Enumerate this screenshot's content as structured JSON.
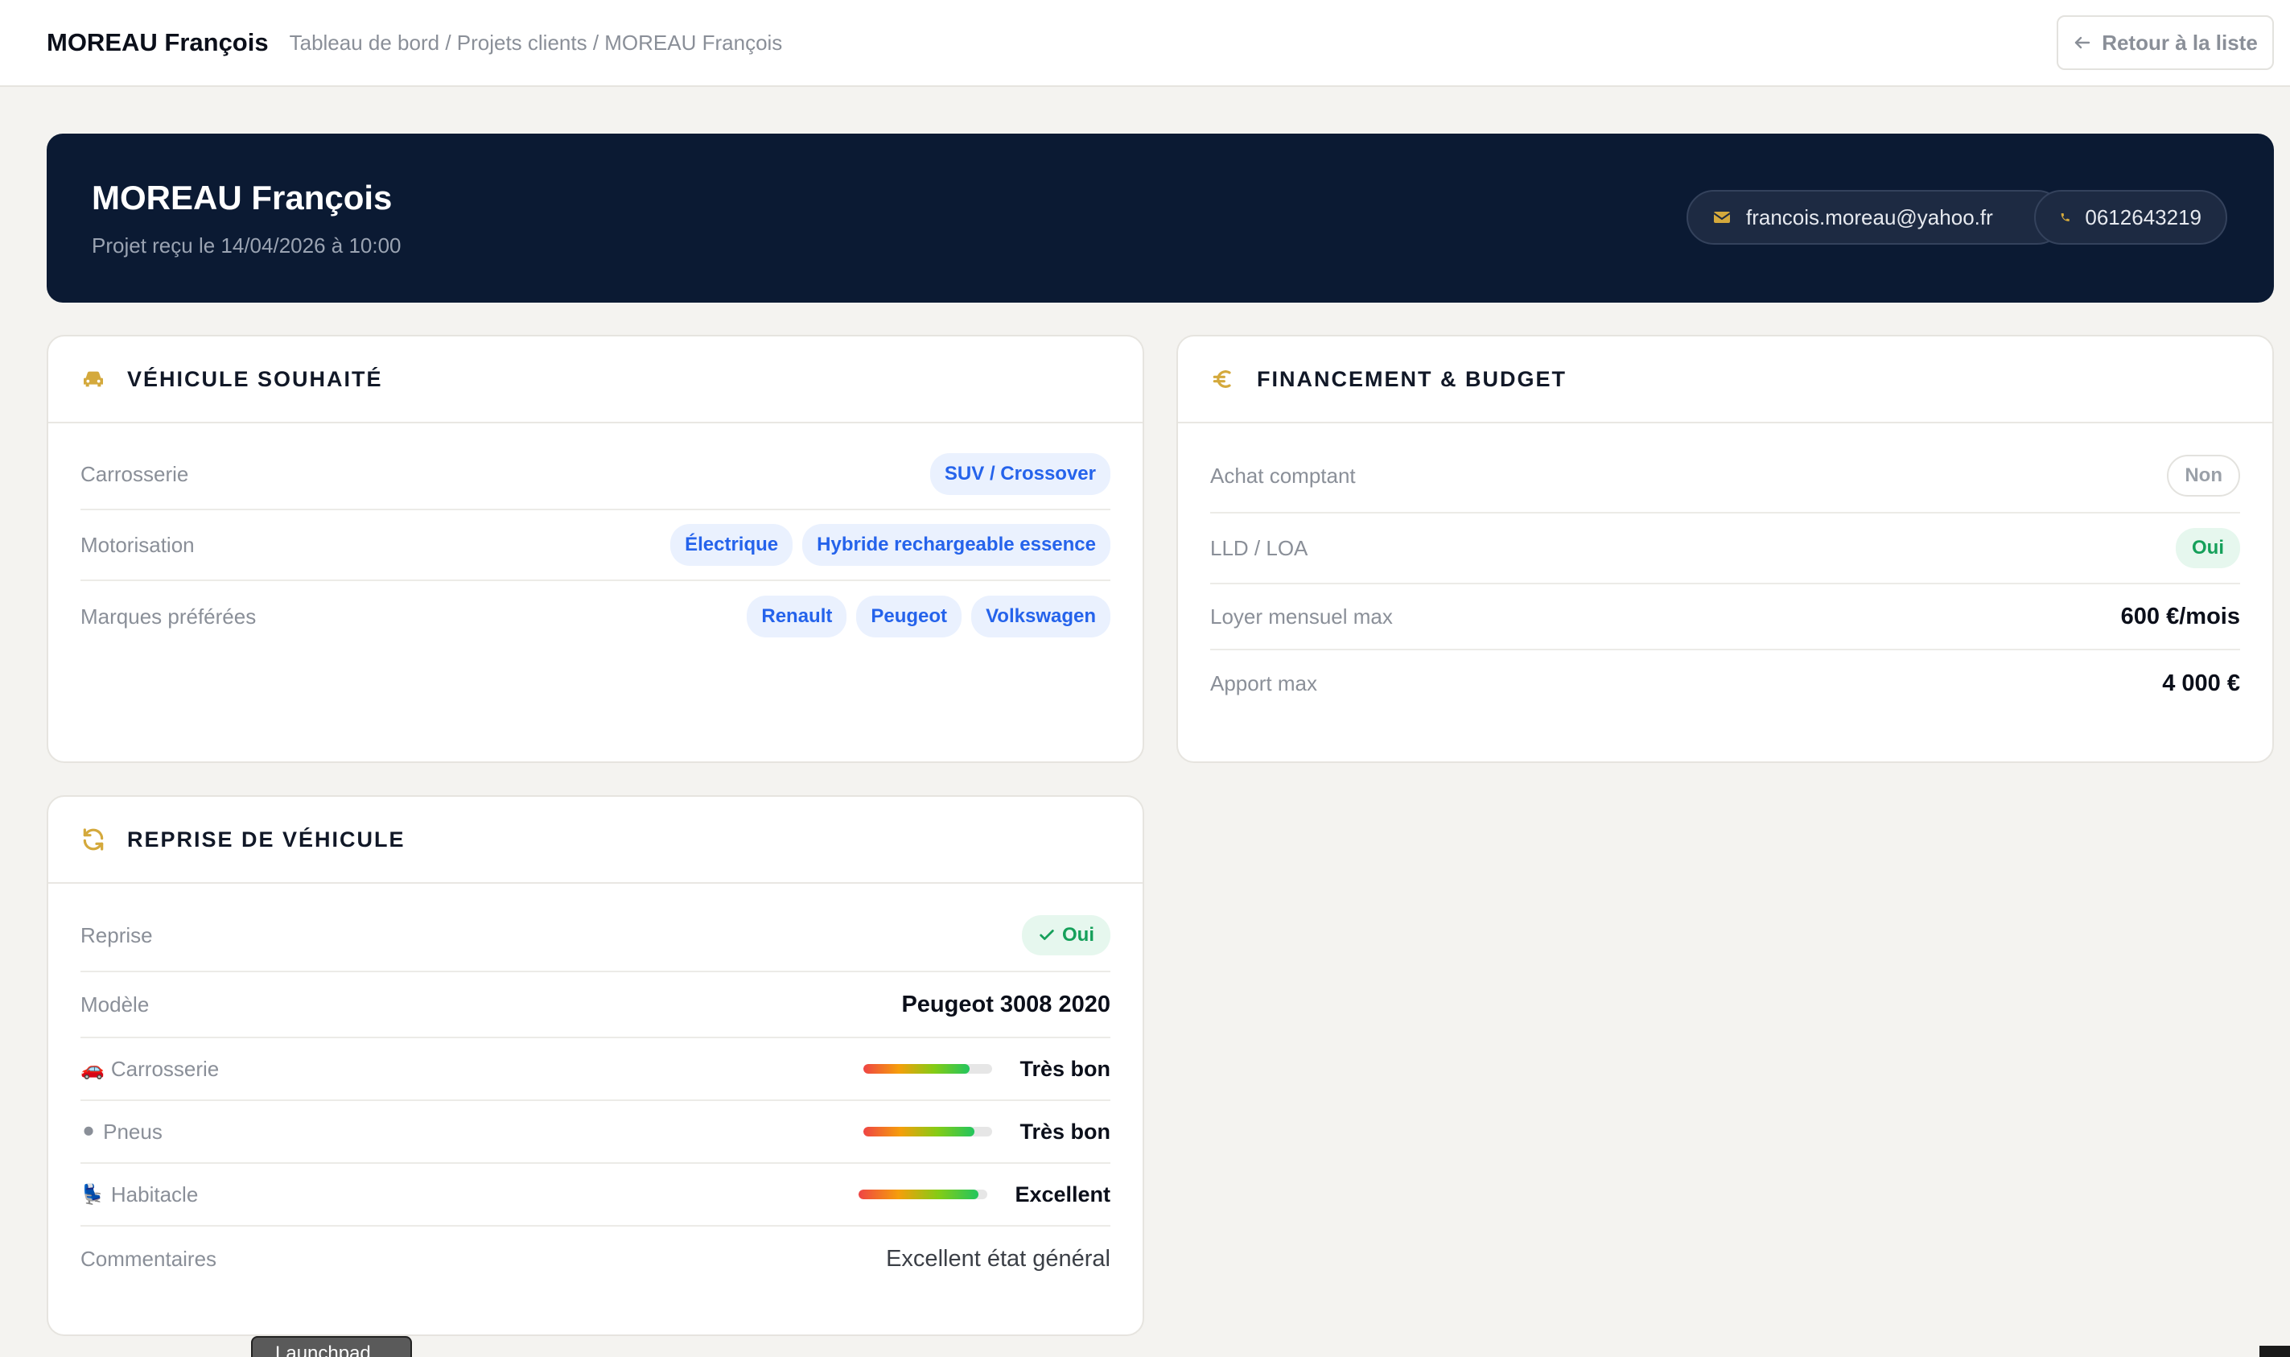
{
  "header": {
    "title": "MOREAU François",
    "breadcrumb": "Tableau de bord / Projets clients / MOREAU François",
    "back_label": "Retour à la liste"
  },
  "hero": {
    "name": "MOREAU François",
    "received": "Projet reçu le 14/04/2026 à 10:00",
    "email": "francois.moreau@yahoo.fr",
    "phone": "0612643219"
  },
  "vehicle": {
    "title": "VÉHICULE SOUHAITÉ",
    "rows": [
      {
        "label": "Carrosserie",
        "tags": [
          "SUV / Crossover"
        ]
      },
      {
        "label": "Motorisation",
        "tags": [
          "Électrique",
          "Hybride rechargeable essence"
        ]
      },
      {
        "label": "Marques préférées",
        "tags": [
          "Renault",
          "Peugeot",
          "Volkswagen"
        ]
      }
    ]
  },
  "finance": {
    "title": "FINANCEMENT & BUDGET",
    "cash_label": "Achat comptant",
    "cash_value": "Non",
    "lease_label": "LLD / LOA",
    "lease_value": "Oui",
    "monthly_label": "Loyer mensuel max",
    "monthly_value": "600 €/mois",
    "deposit_label": "Apport max",
    "deposit_value": "4 000 €"
  },
  "tradein": {
    "title": "REPRISE DE VÉHICULE",
    "reprise_label": "Reprise",
    "reprise_value": "Oui",
    "model_label": "Modèle",
    "model_value": "Peugeot 3008 2020",
    "conditions": [
      {
        "icon": "🚗",
        "label": "Carrosserie",
        "level": 0.82,
        "text": "Très bon"
      },
      {
        "icon": "⚫",
        "label": "Pneus",
        "level": 0.86,
        "text": "Très bon"
      },
      {
        "icon": "💺",
        "label": "Habitacle",
        "level": 0.93,
        "text": "Excellent"
      }
    ],
    "comment_label": "Commentaires",
    "comment_value": "Excellent état général"
  },
  "launchpad_label": "Launchpad",
  "colors": {
    "accent": "#d4a93c",
    "hero_bg": "#0b1a33",
    "tag_blue": "#2563eb",
    "green": "#15a05a"
  }
}
